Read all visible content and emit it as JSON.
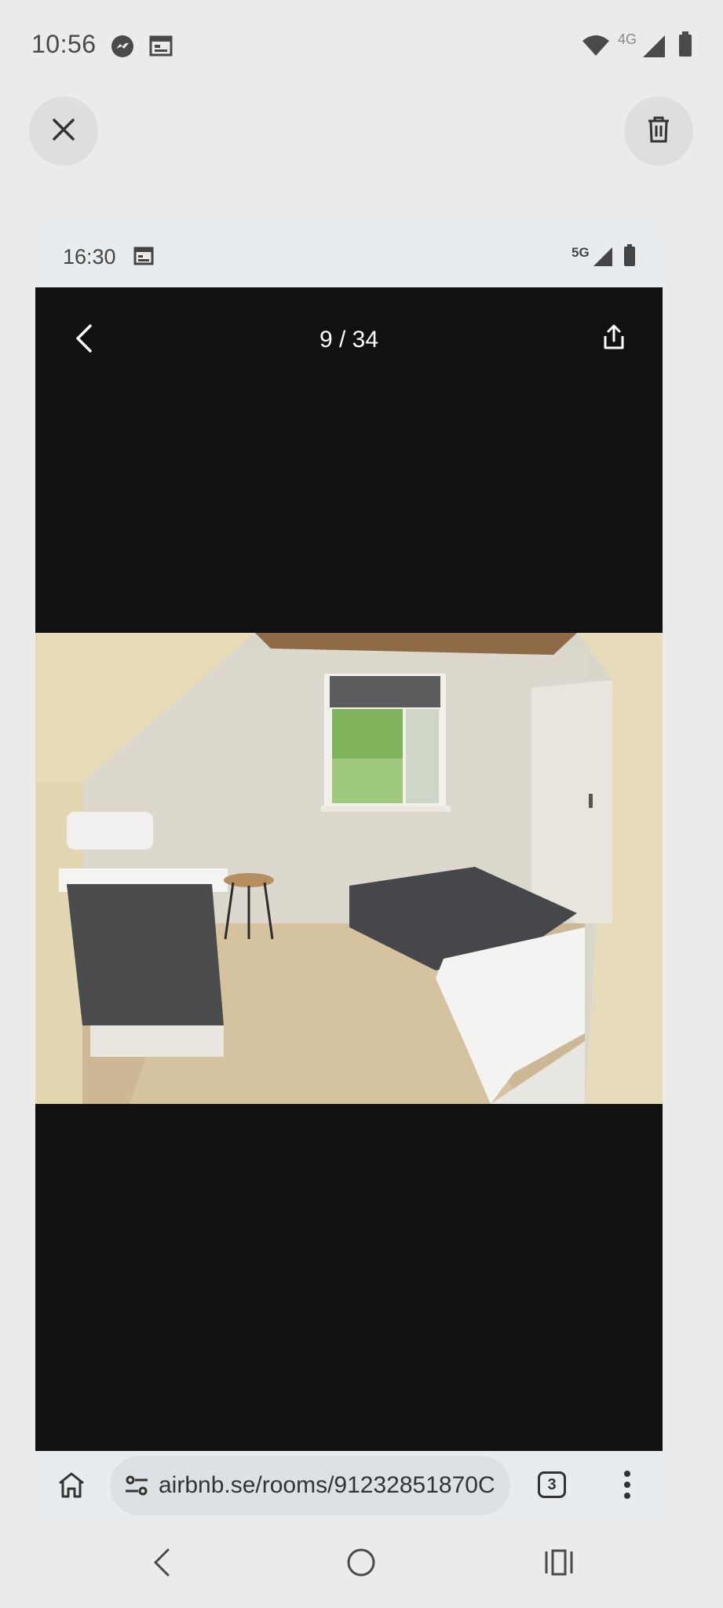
{
  "status_bar": {
    "time": "10:56",
    "network": "4G",
    "icons": [
      "messenger-icon",
      "calendar-icon",
      "wifi-icon",
      "signal-icon",
      "battery-icon"
    ]
  },
  "actions": {
    "close_icon": "close-icon",
    "delete_icon": "trash-icon"
  },
  "screenshot": {
    "status_time": "16:30",
    "network": "5G",
    "viewer": {
      "counter": "9 / 34",
      "back_icon": "chevron-left-icon",
      "share_icon": "share-icon"
    },
    "browser": {
      "url": "airbnb.se/rooms/91232851870C",
      "tab_count": "3",
      "home_icon": "home-icon",
      "site_settings_icon": "tune-icon",
      "menu_icon": "more-vert-icon"
    }
  },
  "colors": {
    "background": "#ebebeb",
    "viewer_bg": "#111111",
    "chrome_bar": "#e9ecef"
  }
}
